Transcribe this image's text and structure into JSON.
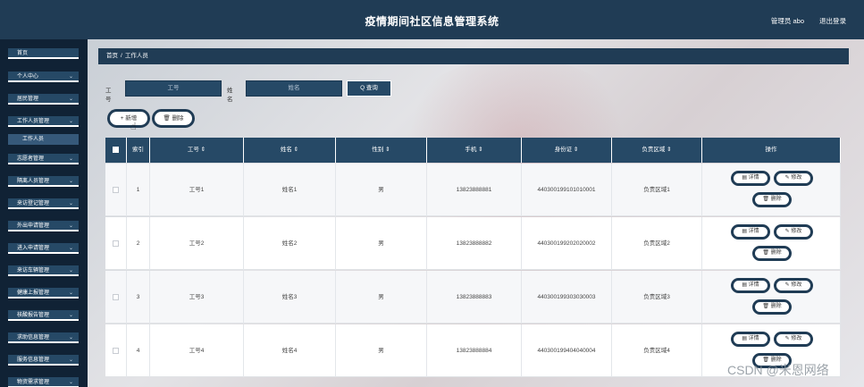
{
  "header": {
    "title": "疫情期间社区信息管理系统",
    "user": "管理员 abo",
    "logout": "退出登录"
  },
  "sidebar": {
    "items": [
      {
        "label": "首页",
        "chevron": false
      },
      {
        "label": "个人中心",
        "chevron": true
      },
      {
        "label": "居民管理",
        "chevron": true
      },
      {
        "label": "工作人员管理",
        "chevron": true
      },
      {
        "label": "志愿者管理",
        "chevron": true
      },
      {
        "label": "隔离人员管理",
        "chevron": true
      },
      {
        "label": "来访登记管理",
        "chevron": true
      },
      {
        "label": "外出申请管理",
        "chevron": true
      },
      {
        "label": "进入申请管理",
        "chevron": true
      },
      {
        "label": "来访车辆管理",
        "chevron": true
      },
      {
        "label": "健康上报管理",
        "chevron": true
      },
      {
        "label": "核酸报告管理",
        "chevron": true
      },
      {
        "label": "求助信息管理",
        "chevron": true
      },
      {
        "label": "服务信息管理",
        "chevron": true
      },
      {
        "label": "物资需求管理",
        "chevron": true
      }
    ],
    "sub_item": "工作人员",
    "chevron_glyph": "⌄"
  },
  "breadcrumb": {
    "home": "首页",
    "sep": "/",
    "current": "工作人员"
  },
  "search": {
    "gonghao_label": "工号",
    "gonghao_placeholder": "工号",
    "xingming_label": "姓名",
    "xingming_placeholder": "姓名",
    "query_button": "Q 查询"
  },
  "actions": {
    "add": "+ 新增",
    "delete": "🗑 删除"
  },
  "table": {
    "columns": [
      "",
      "索引",
      "工号 ⇕",
      "姓名 ⇕",
      "性别 ⇕",
      "手机 ⇕",
      "身份证 ⇕",
      "负责区域 ⇕",
      "操作"
    ],
    "rows": [
      {
        "index": "1",
        "gonghao": "工号1",
        "xingming": "姓名1",
        "xingbie": "男",
        "shouji": "13823888881",
        "shenfenzheng": "440300199101010001",
        "quyu": "负责区域1"
      },
      {
        "index": "2",
        "gonghao": "工号2",
        "xingming": "姓名2",
        "xingbie": "男",
        "shouji": "13823888882",
        "shenfenzheng": "440300199202020002",
        "quyu": "负责区域2"
      },
      {
        "index": "3",
        "gonghao": "工号3",
        "xingming": "姓名3",
        "xingbie": "男",
        "shouji": "13823888883",
        "shenfenzheng": "440300199303030003",
        "quyu": "负责区域3"
      },
      {
        "index": "4",
        "gonghao": "工号4",
        "xingming": "姓名4",
        "xingbie": "男",
        "shouji": "13823888884",
        "shenfenzheng": "440300199404040004",
        "quyu": "负责区域4"
      }
    ],
    "op_detail": "▤ 详情",
    "op_edit": "✎ 修改",
    "op_delete": "🗑 删除"
  },
  "watermark": "CSDN @米恩网络",
  "colors": {
    "nav": "#203c55",
    "nav_item": "#264966",
    "sidebar_bg": "#102235"
  }
}
